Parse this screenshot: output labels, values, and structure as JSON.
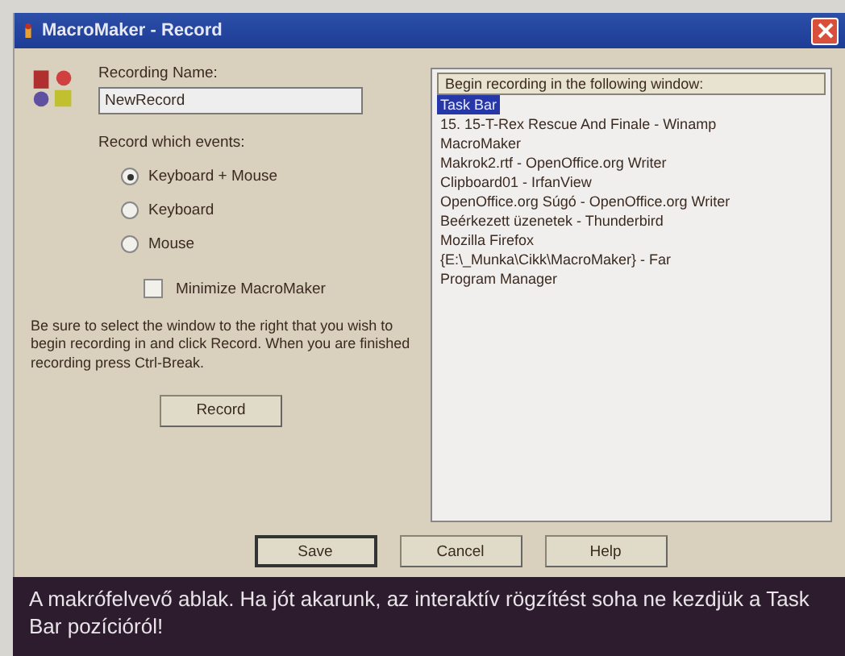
{
  "window": {
    "title": "MacroMaker - Record"
  },
  "recording_name": {
    "label": "Recording Name:",
    "value": "NewRecord"
  },
  "events": {
    "label": "Record which events:",
    "options": [
      {
        "label": "Keyboard + Mouse",
        "selected": true
      },
      {
        "label": "Keyboard",
        "selected": false
      },
      {
        "label": "Mouse",
        "selected": false
      }
    ]
  },
  "minimize": {
    "label": "Minimize MacroMaker",
    "checked": false
  },
  "instructions": "Be sure to select the window to the right that you wish to begin recording in and click Record. When you are finished recording press Ctrl-Break.",
  "record_button": "Record",
  "window_list": {
    "header": "Begin recording in the following window:",
    "items": [
      {
        "label": "Task Bar",
        "selected": true
      },
      {
        "label": "15. 15-T-Rex Rescue And Finale - Winamp",
        "selected": false
      },
      {
        "label": "MacroMaker",
        "selected": false
      },
      {
        "label": "Makrok2.rtf - OpenOffice.org Writer",
        "selected": false
      },
      {
        "label": "Clipboard01 - IrfanView",
        "selected": false
      },
      {
        "label": "OpenOffice.org Súgó - OpenOffice.org Writer",
        "selected": false
      },
      {
        "label": "Beérkezett üzenetek - Thunderbird",
        "selected": false
      },
      {
        "label": "Mozilla Firefox",
        "selected": false
      },
      {
        "label": "{E:\\_Munka\\Cikk\\MacroMaker} - Far",
        "selected": false
      },
      {
        "label": "Program Manager",
        "selected": false
      }
    ]
  },
  "buttons": [
    "Save",
    "Cancel",
    "Help"
  ],
  "caption": "A makrófelvevő ablak. Ha jót akarunk, az interaktív rögzítést soha ne kezdjük a Task Bar pozícióról!"
}
